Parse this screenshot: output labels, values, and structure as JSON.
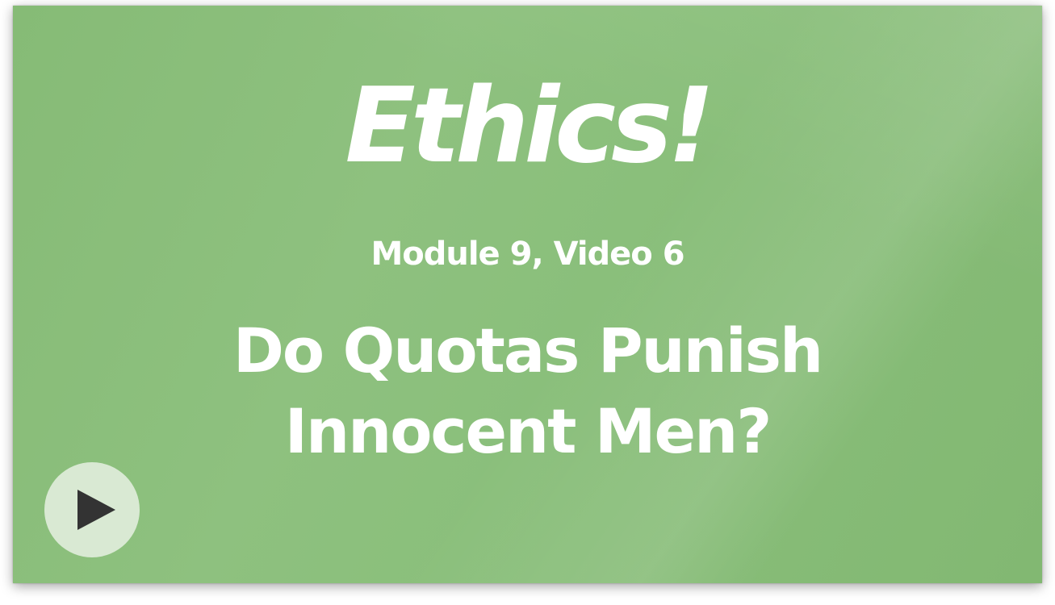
{
  "video": {
    "series_title": "Ethics!",
    "module_label": "Module 9, Video 6",
    "headline_line1": "Do Quotas Punish",
    "headline_line2": "Innocent Men?"
  },
  "controls": {
    "play_icon": "play-icon"
  },
  "colors": {
    "background": "#8abf7b",
    "text": "#ffffff",
    "play_button_bg": "#d9e9d3",
    "play_icon": "#333333"
  }
}
